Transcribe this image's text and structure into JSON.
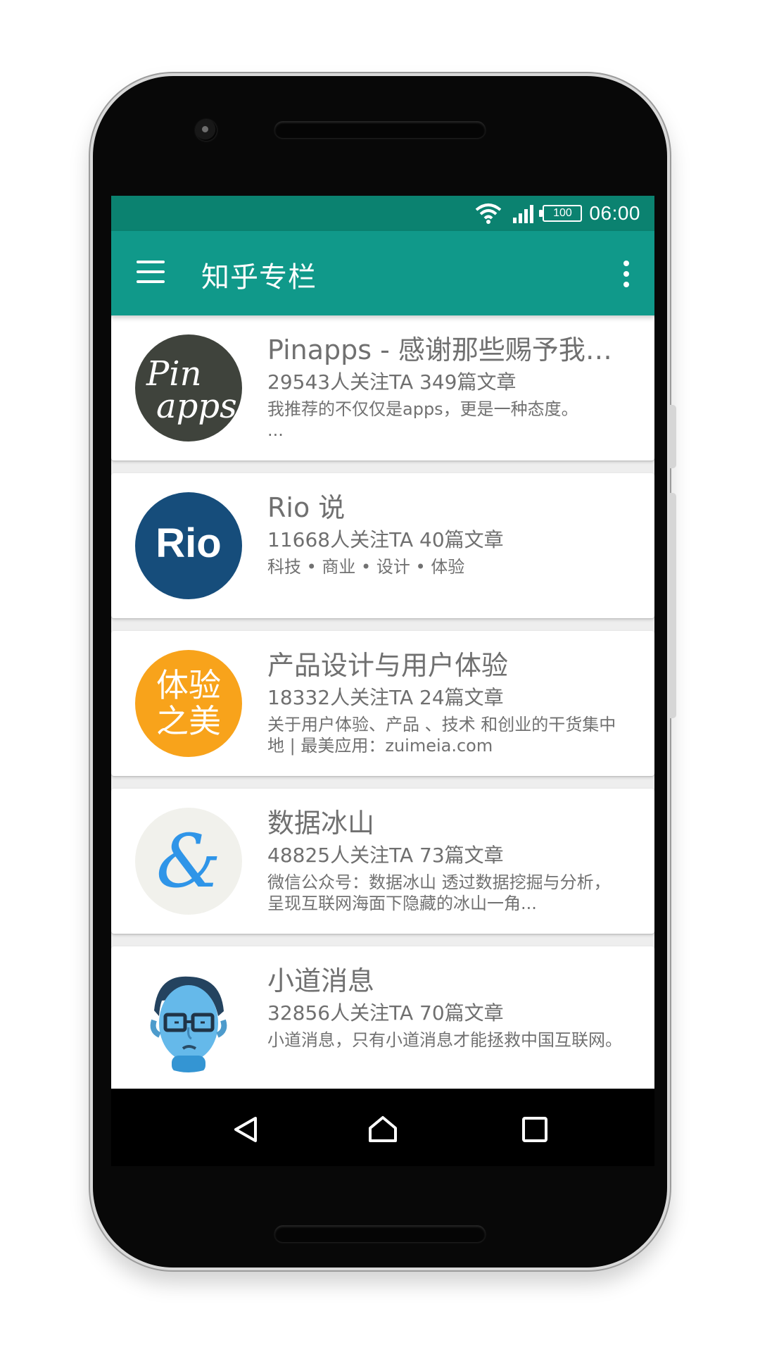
{
  "status_bar": {
    "battery": "100",
    "time": "06:00",
    "icons": [
      "wifi-icon",
      "signal-icon",
      "battery-icon"
    ]
  },
  "app_bar": {
    "title": "知乎专栏",
    "menu_icon": "menu-icon",
    "more_icon": "more-vert-icon"
  },
  "columns": [
    {
      "title": "Pinapps - 感谢那些赐予我们...",
      "meta": "29543人关注TA  349篇文章",
      "description": "我推荐的不仅仅是apps，更是一种态度。\n...",
      "avatar_text": [
        "Pin",
        "apps"
      ],
      "avatar_color": "#3f433c"
    },
    {
      "title": "Rio 说",
      "meta": "11668人关注TA  40篇文章",
      "description": "科技 • 商业 • 设计 • 体验",
      "avatar_text": "Rio",
      "avatar_color": "#164d7b"
    },
    {
      "title": "产品设计与用户体验",
      "meta": "18332人关注TA  24篇文章",
      "description": "关于用户体验、产品 、技术 和创业的干货集中地 | 最美应用：zuimeia.com",
      "avatar_text": [
        "体验",
        "之美"
      ],
      "avatar_color": "#f8a31b"
    },
    {
      "title": "数据冰山",
      "meta": "48825人关注TA  73篇文章",
      "description": "微信公众号：数据冰山  透过数据挖掘与分析，呈现互联网海面下隐藏的冰山一角...",
      "avatar_text": "&",
      "avatar_color": "#f1f1ec"
    },
    {
      "title": "小道消息",
      "meta": "32856人关注TA  70篇文章",
      "description": "小道消息，只有小道消息才能拯救中国互联网。",
      "avatar_color": "#ffffff"
    }
  ],
  "nav": {
    "back": "back-icon",
    "home": "home-icon",
    "recents": "recents-icon"
  },
  "colors": {
    "status_bar": "#0b8270",
    "app_bar": "#10998a",
    "page_background": "#eeeeee"
  }
}
